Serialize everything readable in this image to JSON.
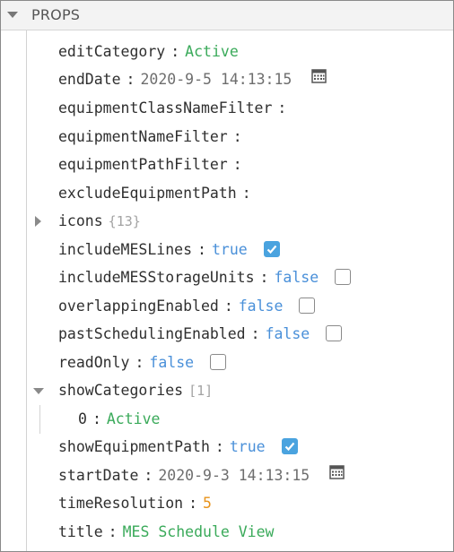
{
  "header": {
    "title": "PROPS"
  },
  "props": {
    "editCategory": {
      "key": "editCategory",
      "value": "Active"
    },
    "endDate": {
      "key": "endDate",
      "value": "2020-9-5 14:13:15"
    },
    "equipmentClassNameFilter": {
      "key": "equipmentClassNameFilter"
    },
    "equipmentNameFilter": {
      "key": "equipmentNameFilter"
    },
    "equipmentPathFilter": {
      "key": "equipmentPathFilter"
    },
    "excludeEquipmentPath": {
      "key": "excludeEquipmentPath"
    },
    "icons": {
      "key": "icons",
      "count": "{13}"
    },
    "includeMESLines": {
      "key": "includeMESLines",
      "value": "true",
      "checked": true
    },
    "includeMESStorageUnits": {
      "key": "includeMESStorageUnits",
      "value": "false",
      "checked": false
    },
    "overlappingEnabled": {
      "key": "overlappingEnabled",
      "value": "false",
      "checked": false
    },
    "pastSchedulingEnabled": {
      "key": "pastSchedulingEnabled",
      "value": "false",
      "checked": false
    },
    "readOnly": {
      "key": "readOnly",
      "value": "false",
      "checked": false
    },
    "showCategories": {
      "key": "showCategories",
      "count": "[1]",
      "items": [
        {
          "index": "0",
          "value": "Active"
        }
      ]
    },
    "showEquipmentPath": {
      "key": "showEquipmentPath",
      "value": "true",
      "checked": true
    },
    "startDate": {
      "key": "startDate",
      "value": "2020-9-3 14:13:15"
    },
    "timeResolution": {
      "key": "timeResolution",
      "value": "5"
    },
    "title": {
      "key": "title",
      "value": "MES Schedule View"
    }
  },
  "colors": {
    "string": "#3aaa5a",
    "boolean": "#4a90d9",
    "number": "#e8931b",
    "checkbox_on": "#4aa3df"
  },
  "icons": {
    "calendar": "calendar-icon",
    "expand": "caret-right-icon",
    "collapse": "caret-down-icon"
  }
}
